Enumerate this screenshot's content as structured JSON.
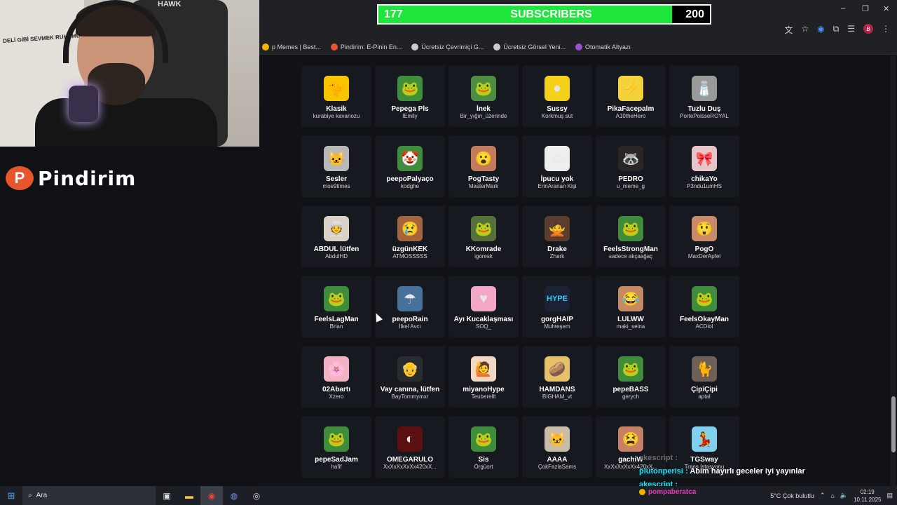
{
  "subscribers": {
    "current": "177",
    "label": "SUBSCRIBERS",
    "goal": "200",
    "progress": 0.885
  },
  "bookmarks": [
    {
      "label": "p Memes | Best...",
      "color": "#f4b400"
    },
    {
      "label": "Pindirim: E-Pinin En...",
      "color": "#e8552d"
    },
    {
      "label": "Ücretsiz Çevrimiçi G...",
      "color": "#cccccc"
    },
    {
      "label": "Ücretsiz Görsel Yeni...",
      "color": "#cccccc"
    },
    {
      "label": "Otomatik Altyazı",
      "color": "#a14bd8"
    }
  ],
  "webcam": {
    "wall_text": "DELİ GİBİ SEVMEK RUHUMUZDA VAR",
    "chair_logo": "HAWK"
  },
  "logo": {
    "mark": "P",
    "text": "Pindirim"
  },
  "emotes": [
    {
      "name": "Klasik",
      "author": "kurabiye kavanozu",
      "glyph": "🐤",
      "bg": "#f7c400"
    },
    {
      "name": "Pepega Pls",
      "author": "lEmily",
      "glyph": "🐸",
      "bg": "#3f8f3a"
    },
    {
      "name": "İnek",
      "author": "Bir_yığın_üzerinde",
      "glyph": "🐸",
      "bg": "#4c8d43"
    },
    {
      "name": "Sussy",
      "author": "Korkmuş süt",
      "glyph": "●",
      "bg": "#f5d11c"
    },
    {
      "name": "PikaFacepalm",
      "author": "A10theHero",
      "glyph": "⚡",
      "bg": "#f3d23b"
    },
    {
      "name": "Tuzlu Duş",
      "author": "PortePoisseROYAL",
      "glyph": "🧂",
      "bg": "#9a9a9a"
    },
    {
      "name": "Sesler",
      "author": "moe9times",
      "glyph": "🐱",
      "bg": "#b9b9b9"
    },
    {
      "name": "peepoPalyaço",
      "author": "kodghe",
      "glyph": "🤡",
      "bg": "#3e8c3c"
    },
    {
      "name": "PogTasty",
      "author": "MasterMark",
      "glyph": "😮",
      "bg": "#c27b5c"
    },
    {
      "name": "İpucu yok",
      "author": "ErinAranan Kişi",
      "glyph": "☺",
      "bg": "#eeeeee"
    },
    {
      "name": "PEDRO",
      "author": "u_meme_g",
      "glyph": "🦝",
      "bg": "#2a2626"
    },
    {
      "name": "chikaYo",
      "author": "P3ndu1umHS",
      "glyph": "🎀",
      "bg": "#e8c5cb"
    },
    {
      "name": "ABDUL lütfen",
      "author": "AbdulHD",
      "glyph": "👳",
      "bg": "#d9d2c5"
    },
    {
      "name": "üzgünKEK",
      "author": "ATMOSSSSS",
      "glyph": "😢",
      "bg": "#a5643b"
    },
    {
      "name": "KKomrade",
      "author": "igoresk",
      "glyph": "🐸",
      "bg": "#55703b"
    },
    {
      "name": "Drake",
      "author": "Zhark",
      "glyph": "🙅",
      "bg": "#5a3d2c"
    },
    {
      "name": "FeelsStrongMan",
      "author": "sadece akçaağaç",
      "glyph": "🐸",
      "bg": "#3f8a3b"
    },
    {
      "name": "PogO",
      "author": "MaxDerApfel",
      "glyph": "😲",
      "bg": "#c98a6a"
    },
    {
      "name": "FeelsLagMan",
      "author": "Brian",
      "glyph": "🐸",
      "bg": "#3e8c3c"
    },
    {
      "name": "peepoRain",
      "author": "İlkel Avcı",
      "glyph": "☂",
      "bg": "#47709a"
    },
    {
      "name": "Ayı Kucaklaşması",
      "author": "SOQ_",
      "glyph": "♥",
      "bg": "#f2a7c7"
    },
    {
      "name": "gorgHAIP",
      "author": "Muhteşem",
      "glyph": "HYPE",
      "bg": "#1b2233"
    },
    {
      "name": "LULWW",
      "author": "maki_seina",
      "glyph": "😂",
      "bg": "#c58a63"
    },
    {
      "name": "FeelsOkayMan",
      "author": "ACDlol",
      "glyph": "🐸",
      "bg": "#3e8c3c"
    },
    {
      "name": "02Abartı",
      "author": "Xzero",
      "glyph": "🌸",
      "bg": "#f3b2c4"
    },
    {
      "name": "Vay canına, lütfen",
      "author": "BayTommymxr",
      "glyph": "👴",
      "bg": "#2a2b2f"
    },
    {
      "name": "miyanoHype",
      "author": "Teuberellt",
      "glyph": "🙋",
      "bg": "#f1d8c5"
    },
    {
      "name": "HAMDANS",
      "author": "BIGHAM_vt",
      "glyph": "🥔",
      "bg": "#e7c06a"
    },
    {
      "name": "pepeBASS",
      "author": "gerych",
      "glyph": "🐸",
      "bg": "#3e8c3c"
    },
    {
      "name": "ÇipiÇipi",
      "author": "aptal",
      "glyph": "🐈",
      "bg": "#6d6157"
    },
    {
      "name": "pepeSadJam",
      "author": "hafif",
      "glyph": "🐸",
      "bg": "#3e8c3c"
    },
    {
      "name": "OMEGARULO",
      "author": "XxXxXxXxXx420xX...",
      "glyph": "◐",
      "bg": "#5a1010"
    },
    {
      "name": "Sis",
      "author": "Örgüort",
      "glyph": "🐸",
      "bg": "#3e8c3c"
    },
    {
      "name": "AAAA",
      "author": "ÇokFazlaSams",
      "glyph": "🐱",
      "bg": "#c9bca9"
    },
    {
      "name": "gachiW",
      "author": "XxXxXxXxXx420xX...",
      "glyph": "😫",
      "bg": "#c58065"
    },
    {
      "name": "TGSway",
      "author": "Trans İstasyonu",
      "glyph": "💃",
      "bg": "#7fd1ef"
    }
  ],
  "chat": [
    {
      "user": "akescript :",
      "message": "",
      "muted": true
    },
    {
      "user": "plutonperisi :",
      "message": "Abim hayırlı geceler iyi yayınlar",
      "muted": false
    },
    {
      "user": "akescript :",
      "message": "",
      "muted": false
    }
  ],
  "taskbar": {
    "search_placeholder": "Ara",
    "notification_user": "pompaberatca",
    "weather": "5°C  Çok bulutlu",
    "time": "02:19",
    "date": "10.11.2025"
  }
}
